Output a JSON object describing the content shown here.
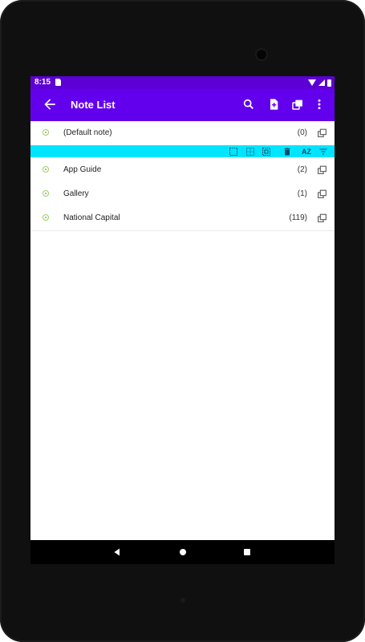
{
  "status": {
    "time": "8:15"
  },
  "appbar": {
    "title": "Note List",
    "back_icon": "arrow-back-icon",
    "actions": [
      "search-icon",
      "add-note-icon",
      "copy-notes-icon",
      "more-vert-icon"
    ],
    "color": "#6200ee",
    "status_color": "#5d00d6"
  },
  "rows": [
    {
      "label": "(Default note)",
      "count": "(0)"
    },
    {
      "label": "App Guide",
      "count": "(2)"
    },
    {
      "label": "Gallery",
      "count": "(1)"
    },
    {
      "label": "National Capital",
      "count": "(119)"
    }
  ],
  "toolbar": {
    "color": "#00e5ff",
    "icons": [
      "select-all-icon",
      "select-grid-icon",
      "deselect-icon",
      "delete-icon",
      "sort-az-icon",
      "filter-icon"
    ],
    "sort_label": "AZ"
  },
  "navbar": {
    "icons": [
      "nav-back-icon",
      "nav-home-icon",
      "nav-recents-icon"
    ]
  }
}
